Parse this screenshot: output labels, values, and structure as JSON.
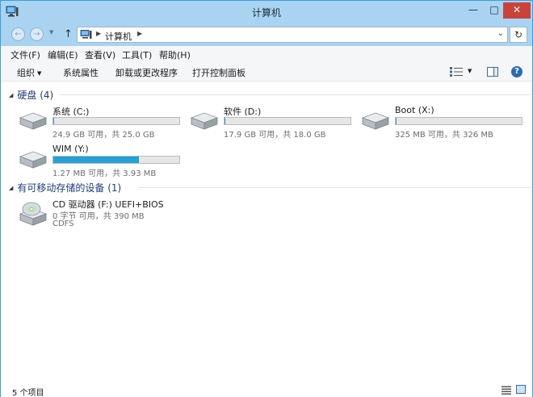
{
  "window": {
    "title": "计算机",
    "min_label": "—",
    "max_label": "□",
    "close_label": "✕"
  },
  "nav": {
    "back_glyph": "←",
    "forward_glyph": "→",
    "up_glyph": "↑",
    "address": "计算机",
    "refresh_glyph": "↻"
  },
  "menu": {
    "items": [
      "文件(F)",
      "编辑(E)",
      "查看(V)",
      "工具(T)",
      "帮助(H)"
    ]
  },
  "commands": {
    "organize": "组织",
    "items": [
      "系统属性",
      "卸载或更改程序",
      "打开控制面板"
    ],
    "help_glyph": "?"
  },
  "groups": {
    "hard_disks": "硬盘 (4)",
    "removable": "有可移动存储的设备 (1)"
  },
  "drives": [
    {
      "name": "系统 (C:)",
      "info": "24.9 GB 可用，共 25.0 GB",
      "used_fraction": 0.004
    },
    {
      "name": "软件 (D:)",
      "info": "17.9 GB 可用，共 18.0 GB",
      "used_fraction": 0.006
    },
    {
      "name": "Boot (X:)",
      "info": "325 MB 可用，共 326 MB",
      "used_fraction": 0.003
    },
    {
      "name": "WIM (Y:)",
      "info": "1.27 MB 可用，共 3.93 MB",
      "used_fraction": 0.68
    }
  ],
  "cd_drive": {
    "name": "CD 驱动器 (F:) UEFI+BIOS",
    "info": "0 字节 可用，共 390 MB",
    "fs": "CDFS"
  },
  "status": {
    "item_count": "5 个项目"
  },
  "icons": {
    "app": "computer-icon",
    "hdd": "hard-drive-icon",
    "cd": "cd-drive-icon"
  },
  "colors": {
    "title_bar": "#a9d3f1",
    "progress_fill": "#26a0da",
    "group_header": "#1e3c78",
    "close_button": "#c9433b"
  }
}
